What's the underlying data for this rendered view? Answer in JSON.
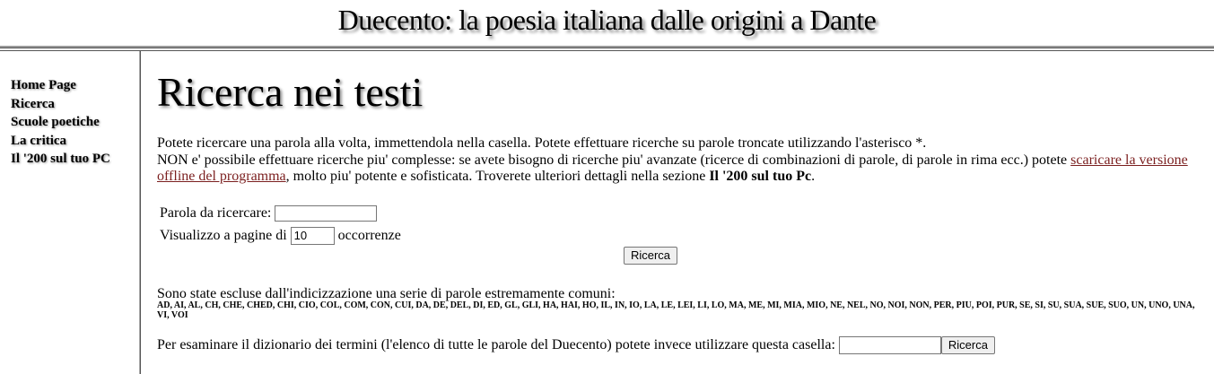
{
  "header": {
    "site_title": "Duecento: la poesia italiana dalle origini a Dante"
  },
  "nav": {
    "items": [
      {
        "label": "Home Page"
      },
      {
        "label": "Ricerca"
      },
      {
        "label": "Scuole poetiche"
      },
      {
        "label": "La critica"
      },
      {
        "label": "Il '200 sul tuo PC"
      }
    ]
  },
  "main": {
    "title": "Ricerca nei testi",
    "intro_line1": "Potete ricercare una parola alla volta, immettendola nella casella. Potete effettuare ricerche su parole troncate utilizzando l'asterisco *.",
    "intro_line2_before": "NON e' possibile effettuare ricerche piu' complesse: se avete bisogno di ricerche piu' avanzate (ricerce di combinazioni di parole, di parole in rima ecc.) potete ",
    "intro_link": "scaricare la versione offline del programma",
    "intro_line2_after": ", molto piu' potente e sofisticata. Troverete ulteriori dettagli nella sezione ",
    "intro_section_name": "Il '200 sul tuo Pc",
    "intro_end": "."
  },
  "search_form": {
    "word_label": "Parola da ricercare:",
    "word_value": "",
    "page_label_before": "Visualizzo a pagine di",
    "page_size_value": "10",
    "page_label_after": "occorrenze",
    "submit_label": "Ricerca"
  },
  "excluded": {
    "heading": "Sono state escluse dall'indicizzazione una serie di parole estremamente comuni:",
    "words": "AD, AI, AL, CH, CHE, CHED, CHI, CIO, COL, COM, CON, CUI, DA, DE, DEL, DI, ED, GL, GLI, HA, HAI, HO, IL, IN, IO, LA, LE, LEI, LI, LO, MA, ME, MI, MIA, MIO, NE, NEL, NO, NOI, NON, PER, PIU, POI, PUR, SE, SI, SU, SUA, SUE, SUO, UN, UNO, UNA, VI, VOI"
  },
  "dictionary": {
    "label": "Per esaminare il dizionario dei termini (l'elenco di tutte le parole del Duecento) potete invece utilizzare questa casella:",
    "input_value": "",
    "submit_label": "Ricerca"
  },
  "colors": {
    "link": "#7b1f1f",
    "rule": "#555555"
  }
}
